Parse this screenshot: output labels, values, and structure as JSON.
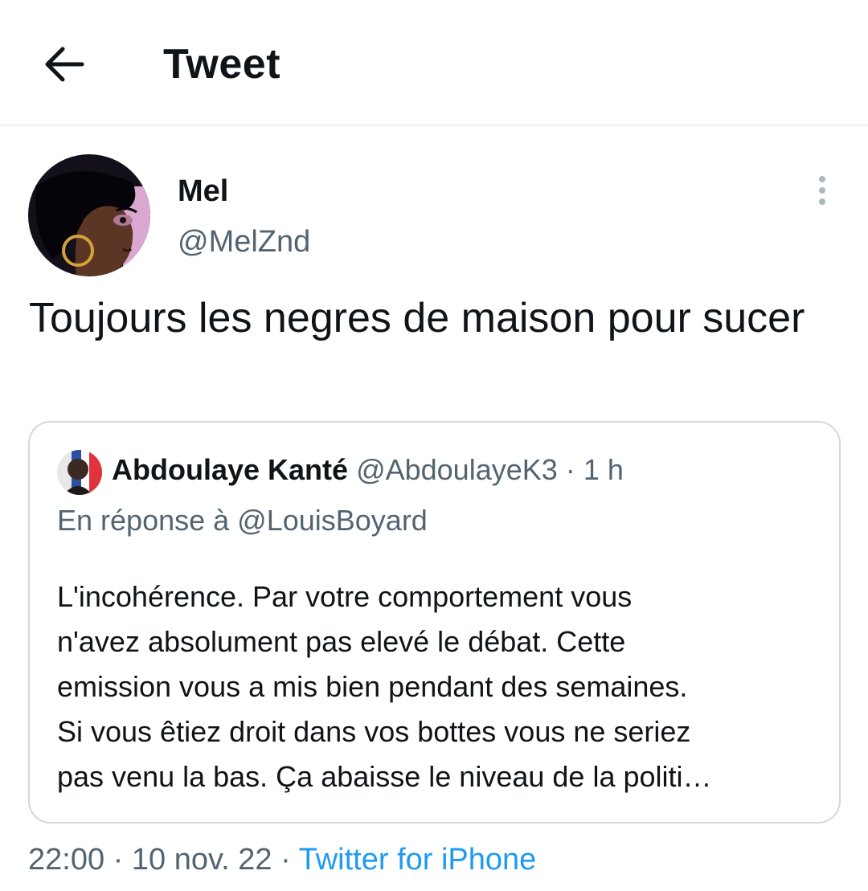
{
  "header": {
    "title": "Tweet",
    "back_icon": "arrow-left-icon"
  },
  "tweet": {
    "author": {
      "name": "Mel",
      "handle": "@MelZnd"
    },
    "more_icon": "more-vertical-icon",
    "text": "Toujours les negres de maison pour sucer",
    "timestamp": "22:00",
    "separator": "·",
    "date": "10 nov. 22",
    "source": "Twitter for iPhone"
  },
  "quote": {
    "author": {
      "name": "Abdoulaye Kanté",
      "handle": "@AbdoulayeK3"
    },
    "separator": "·",
    "time": "1 h",
    "reply_to": "En réponse à @LouisBoyard",
    "text_lines": [
      "L'incohérence. Par votre comportement vous",
      "n'avez absolument pas elevé le débat. Cette",
      "emission vous a mis bien pendant des semaines.",
      "Si vous êtiez droit dans vos bottes vous ne seriez",
      "pas venu la bas. Ça abaisse le niveau de la politi…"
    ]
  },
  "colors": {
    "text_primary": "#0f1419",
    "text_secondary": "#536471",
    "link": "#1d9bf0",
    "border": "#cfd9de",
    "divider": "#eff3f4"
  }
}
